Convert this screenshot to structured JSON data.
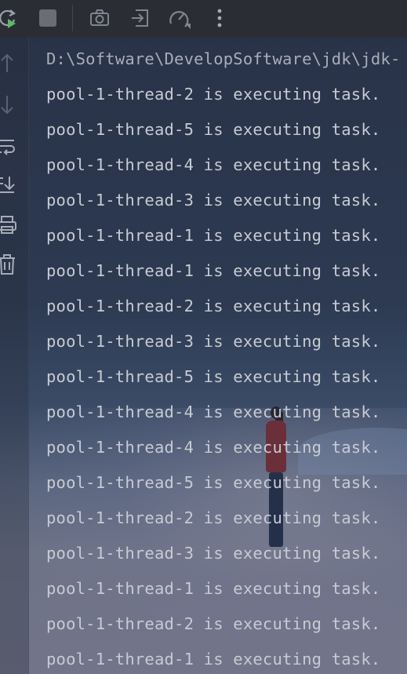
{
  "toolbar": {
    "icons": [
      "rerun-icon",
      "stop-icon",
      "camera-icon",
      "exit-icon",
      "profiler-icon",
      "more-icon"
    ]
  },
  "gutter": {
    "icons": [
      "up-arrow-icon",
      "down-arrow-icon",
      "soft-wrap-icon",
      "scroll-to-end-icon",
      "print-icon",
      "trash-icon"
    ]
  },
  "console": {
    "lines": [
      "D:\\Software\\DevelopSoftware\\jdk\\jdk-",
      "pool-1-thread-2 is executing task.",
      "pool-1-thread-5 is executing task.",
      "pool-1-thread-4 is executing task.",
      "pool-1-thread-3 is executing task.",
      "pool-1-thread-1 is executing task.",
      "pool-1-thread-1 is executing task.",
      "pool-1-thread-2 is executing task.",
      "pool-1-thread-3 is executing task.",
      "pool-1-thread-5 is executing task.",
      "pool-1-thread-4 is executing task.",
      "pool-1-thread-4 is executing task.",
      "pool-1-thread-5 is executing task.",
      "pool-1-thread-2 is executing task.",
      "pool-1-thread-3 is executing task.",
      "pool-1-thread-1 is executing task.",
      "pool-1-thread-2 is executing task.",
      "pool-1-thread-1 is executing task."
    ]
  },
  "colors": {
    "toolbar_bg": "#2b2d35",
    "text": "#c7cbd3",
    "rerun_green": "#5fb865",
    "icon_gray": "#7f8490"
  }
}
